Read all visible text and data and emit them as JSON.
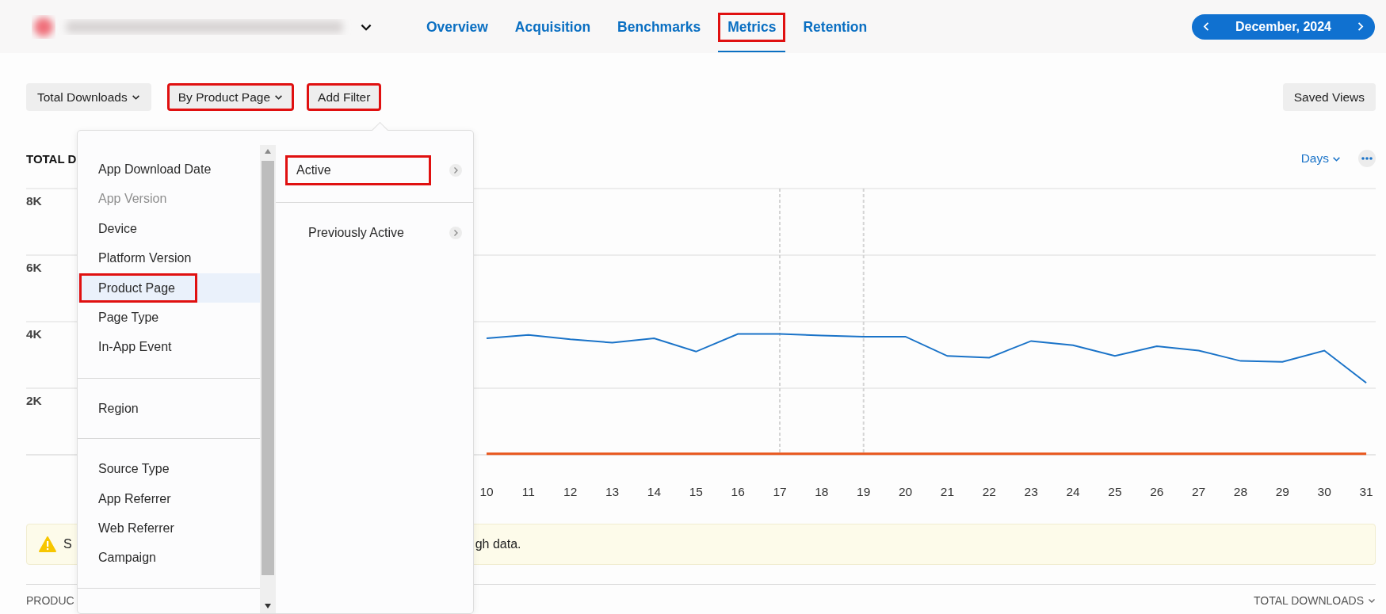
{
  "app_header": {
    "tabs": [
      {
        "label": "Overview",
        "selected": false,
        "highlighted": false
      },
      {
        "label": "Acquisition",
        "selected": false,
        "highlighted": false
      },
      {
        "label": "Benchmarks",
        "selected": false,
        "highlighted": false
      },
      {
        "label": "Metrics",
        "selected": true,
        "highlighted": true
      },
      {
        "label": "Retention",
        "selected": false,
        "highlighted": false
      }
    ],
    "date_range": {
      "label": "December, 2024"
    }
  },
  "filters": [
    {
      "label": "Total Downloads",
      "kind": "dropdown",
      "highlighted": false
    },
    {
      "label": "By Product Page",
      "kind": "dropdown",
      "highlighted": true
    },
    {
      "label": "Add Filter",
      "kind": "button",
      "highlighted": true
    }
  ],
  "saved_views": {
    "label": "Saved Views"
  },
  "chart": {
    "title": "TOTAL D",
    "period": "Days",
    "chart_data": {
      "type": "line",
      "categories": [
        "10",
        "11",
        "12",
        "13",
        "14",
        "15",
        "16",
        "17",
        "18",
        "19",
        "20",
        "21",
        "22",
        "23",
        "24",
        "25",
        "26",
        "27",
        "28",
        "29",
        "30",
        "31"
      ],
      "ylim": [
        0,
        8000
      ],
      "grid": true,
      "yticks": [
        {
          "value": 2000,
          "label": "2K"
        },
        {
          "value": 4000,
          "label": "4K"
        },
        {
          "value": 6000,
          "label": "6K"
        },
        {
          "value": 8000,
          "label": "8K"
        }
      ],
      "series": [
        {
          "color": "#1a73c8",
          "values": [
            3500,
            3600,
            3470,
            3370,
            3500,
            3100,
            3630,
            3630,
            3580,
            3550,
            3550,
            2970,
            2920,
            3420,
            3290,
            2970,
            3260,
            3130,
            2820,
            2790,
            3130,
            2160
          ]
        },
        {
          "color": "#e8561c",
          "values": [
            30,
            30,
            30,
            30,
            30,
            30,
            30,
            30,
            30,
            30,
            30,
            30,
            30,
            30,
            30,
            30,
            30,
            30,
            30,
            30,
            30,
            30
          ]
        }
      ],
      "annotations": [
        {
          "x": "17"
        },
        {
          "x": "19"
        }
      ]
    }
  },
  "warning": {
    "text_start": "S",
    "text_end": "gh data."
  },
  "table_header": {
    "column_1": "PRODUC",
    "column_2": "TOTAL DOWNLOADS"
  },
  "filter_menu": {
    "groups": [
      {
        "items": [
          {
            "label": "App Download Date",
            "selected": false,
            "disabled": false,
            "highlighted": false
          },
          {
            "label": "App Version",
            "selected": false,
            "disabled": true,
            "highlighted": false
          },
          {
            "label": "Device",
            "selected": false,
            "disabled": false,
            "highlighted": false
          },
          {
            "label": "Platform Version",
            "selected": false,
            "disabled": false,
            "highlighted": false
          },
          {
            "label": "Product Page",
            "selected": true,
            "disabled": false,
            "highlighted": true
          },
          {
            "label": "Page Type",
            "selected": false,
            "disabled": false,
            "highlighted": false
          },
          {
            "label": "In-App Event",
            "selected": false,
            "disabled": false,
            "highlighted": false
          }
        ]
      },
      {
        "items": [
          {
            "label": "Region",
            "selected": false,
            "disabled": false,
            "highlighted": false
          }
        ]
      },
      {
        "items": [
          {
            "label": "Source Type",
            "selected": false,
            "disabled": false,
            "highlighted": false
          },
          {
            "label": "App Referrer",
            "selected": false,
            "disabled": false,
            "highlighted": false
          },
          {
            "label": "Web Referrer",
            "selected": false,
            "disabled": false,
            "highlighted": false
          },
          {
            "label": "Campaign",
            "selected": false,
            "disabled": false,
            "highlighted": false
          }
        ]
      }
    ],
    "submenu": [
      {
        "label": "Active",
        "highlighted": true
      },
      {
        "label": "Previously Active",
        "highlighted": false
      }
    ]
  }
}
